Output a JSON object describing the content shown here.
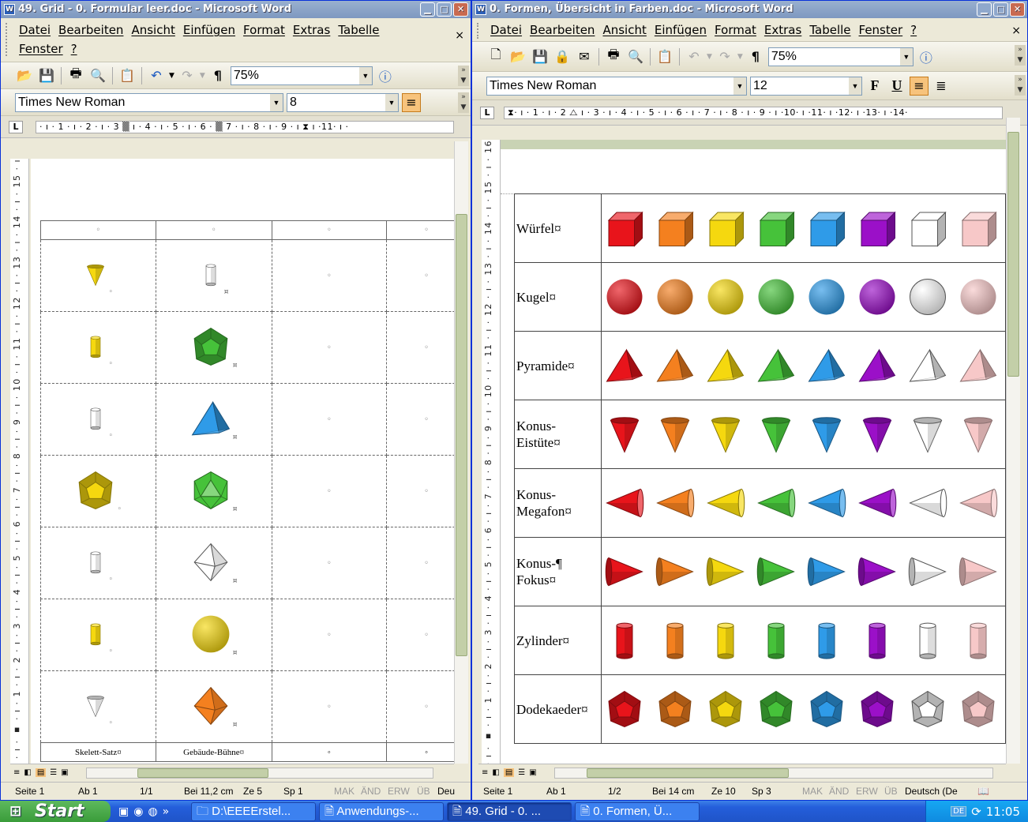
{
  "left_window": {
    "title": "49. Grid - 0. Formular leer.doc - Microsoft Word",
    "menu": [
      "Datei",
      "Bearbeiten",
      "Ansicht",
      "Einfügen",
      "Format",
      "Extras",
      "Tabelle",
      "Fenster",
      "?"
    ],
    "menu_close": "×",
    "zoom": "75%",
    "font_name": "Times New Roman",
    "font_size": "8",
    "ruler_text": "· ı · 1 · ı · 2 · ı · 3 ▒ ı · 4 · ı · 5 · ı · 6 · ▒ 7 · ı · 8 · ı · 9 · ı ⧗ ı ·11· ı ·",
    "vruler_text": "· 1 · ı · ▪ · ı · 1 · ı · 2 · ı · 3 · ı · 4 · ı · 5 · ı · 6 · ı · 7 · ı · 8 · ı · 9 · ı · 10 · ı · 11 · ı · 12 · ı · 13 · ı · 14 · ı · 15 · ı",
    "grid_header_marks": [
      "◦",
      "◦",
      "◦",
      "◦"
    ],
    "grid_rows": [
      {
        "c1": "cone-yellow",
        "c2": "cylinder-white"
      },
      {
        "c1": "cylinder-yellow",
        "c2": "dodecahedron-green"
      },
      {
        "c1": "cylinder-white",
        "c2": "pyramid-blue"
      },
      {
        "c1": "dodecahedron-yellow",
        "c2": "icosahedron-green"
      },
      {
        "c1": "cylinder-white",
        "c2": "octahedron-white"
      },
      {
        "c1": "cylinder-yellow",
        "c2": "sphere-yellow"
      },
      {
        "c1": "cone-white",
        "c2": "octahedron-orange"
      }
    ],
    "cell_mark_a": "◦",
    "cell_mark_b": "¤",
    "footer_labels": [
      "Skelett-Satz¤",
      "Gebäude-Bühne¤",
      "◦",
      "◦"
    ],
    "status": {
      "page": "Seite 1",
      "section": "Ab 1",
      "pages": "1/1",
      "position": "Bei 11,2 cm",
      "line": "Ze 5",
      "column": "Sp 1",
      "mak": "MAK",
      "and": "ÄND",
      "erw": "ERW",
      "ub": "ÜB",
      "lang": "Deu"
    }
  },
  "right_window": {
    "title": "0. Formen, Übersicht in Farben.doc - Microsoft Word",
    "menu": [
      "Datei",
      "Bearbeiten",
      "Ansicht",
      "Einfügen",
      "Format",
      "Extras",
      "Tabelle",
      "Fenster",
      "?"
    ],
    "menu_close": "×",
    "zoom": "75%",
    "font_name": "Times New Roman",
    "font_size": "12",
    "bold_label": "F",
    "underline_label": "U",
    "ruler_text": "⧗· ı · 1 · ı · 2 ⧍ ı · 3 · ı · 4 · ı · 5 · ı · 6 · ı · 7 · ı · 8 · ı · 9 · ı ·10· ı ·11· ı ·12· ı ·13· ı ·14·",
    "vruler_text": "· 1 · ı · ▪ · ı · 1 · ı · 2 · ı · 3 · ı · 4 · ı · 5 · ı · 6 · ı · 7 · ı · 8 · ı · 9 · ı · 10 · ı · 11 · ı · 12 · ı · 13 · ı · 14 · ı · 15 · ı · 16",
    "colors": [
      "#e8141b",
      "#f4801f",
      "#f5d80f",
      "#46c23a",
      "#2f9be8",
      "#9b10c8",
      "#ffffff",
      "#f7c8c8"
    ],
    "rows": [
      {
        "label_l1": "Würfel¤",
        "label_l2": "",
        "shape": "cube"
      },
      {
        "label_l1": "Kugel¤",
        "label_l2": "",
        "shape": "sphere"
      },
      {
        "label_l1": "Pyramide¤",
        "label_l2": "",
        "shape": "pyramid"
      },
      {
        "label_l1": "Konus-",
        "label_l2": "Eistüte¤",
        "shape": "cone-down"
      },
      {
        "label_l1": "Konus-",
        "label_l2": "Megafon¤",
        "shape": "cone-left"
      },
      {
        "label_l1": "Konus-¶",
        "label_l2": "Fokus¤",
        "shape": "cone-right"
      },
      {
        "label_l1": "Zylinder¤",
        "label_l2": "",
        "shape": "cylinder"
      },
      {
        "label_l1": "Dodekaeder¤",
        "label_l2": "",
        "shape": "dodecahedron"
      }
    ],
    "status": {
      "page": "Seite 1",
      "section": "Ab 1",
      "pages": "1/2",
      "position": "Bei 14 cm",
      "line": "Ze 10",
      "column": "Sp 3",
      "mak": "MAK",
      "and": "ÄND",
      "erw": "ERW",
      "ub": "ÜB",
      "lang": "Deutsch (De"
    }
  },
  "taskbar": {
    "start": "Start",
    "tasks": [
      {
        "label": "D:\\EEEErstel...",
        "active": false
      },
      {
        "label": "Anwendungs-...",
        "active": false
      },
      {
        "label": "49. Grid - 0. ...",
        "active": true
      },
      {
        "label": "0. Formen, Ü...",
        "active": false
      }
    ],
    "tray_lang": "DE",
    "clock": "11:05"
  }
}
